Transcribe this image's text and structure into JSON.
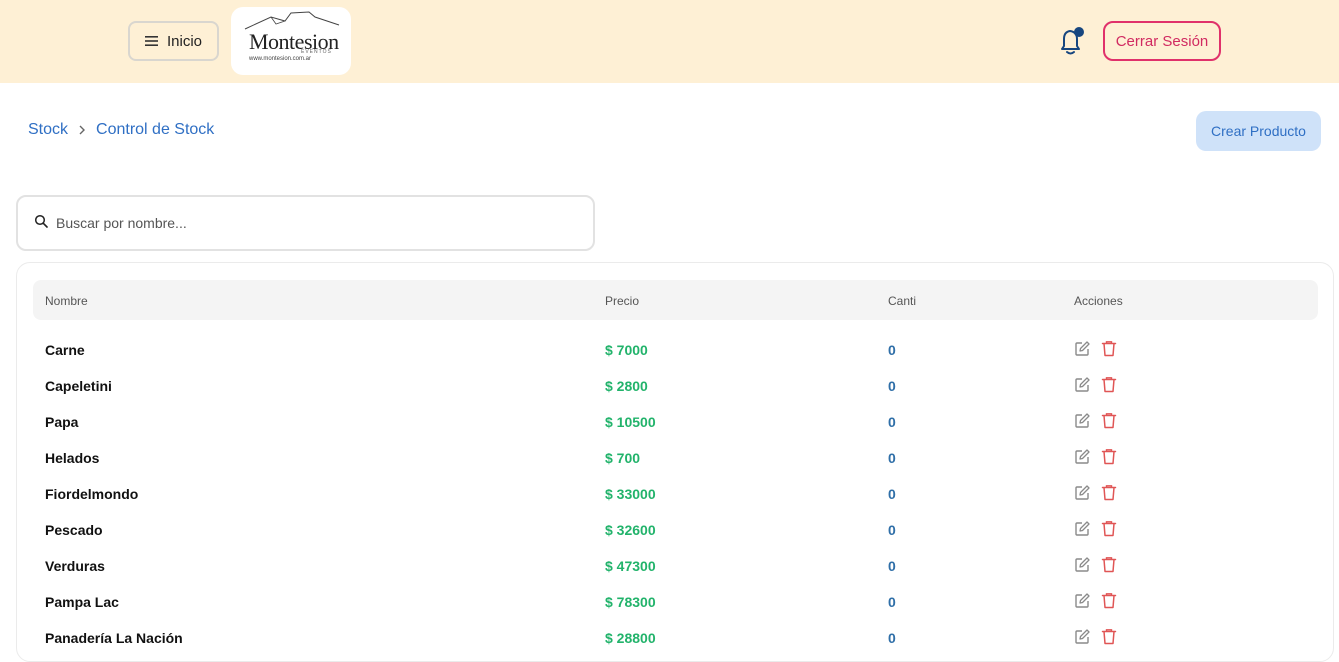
{
  "header": {
    "menu_label": "Inicio",
    "logo_text": "Montesion",
    "logo_sub": "EVENTOS",
    "logo_url": "www.montesion.com.ar",
    "logout_label": "Cerrar Sesión"
  },
  "breadcrumb": {
    "root": "Stock",
    "current": "Control de Stock"
  },
  "actions": {
    "create_label": "Crear Producto"
  },
  "search": {
    "placeholder": "Buscar por nombre..."
  },
  "table": {
    "columns": [
      "Nombre",
      "Precio",
      "Canti",
      "Acciones"
    ],
    "rows": [
      {
        "name": "Carne",
        "price": "$ 7000",
        "qty": "0"
      },
      {
        "name": "Capeletini",
        "price": "$ 2800",
        "qty": "0"
      },
      {
        "name": "Papa",
        "price": "$ 10500",
        "qty": "0"
      },
      {
        "name": "Helados",
        "price": "$ 700",
        "qty": "0"
      },
      {
        "name": "Fiordelmondo",
        "price": "$ 33000",
        "qty": "0"
      },
      {
        "name": "Pescado",
        "price": "$ 32600",
        "qty": "0"
      },
      {
        "name": "Verduras",
        "price": "$ 47300",
        "qty": "0"
      },
      {
        "name": "Pampa Lac",
        "price": "$ 78300",
        "qty": "0"
      },
      {
        "name": "Panadería La Nación",
        "price": "$ 28800",
        "qty": "0"
      }
    ]
  },
  "colors": {
    "header_bg": "#fef0d5",
    "accent_blue": "#2f6fc4",
    "logout_red": "#e0316b",
    "price_green": "#22b36b",
    "delete_red": "#e05555"
  }
}
